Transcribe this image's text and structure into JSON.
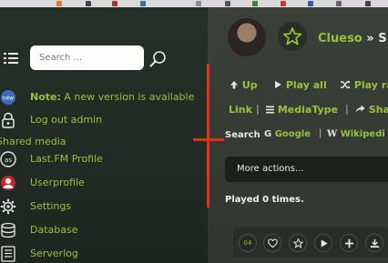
{
  "sidebar": {
    "search_placeholder": "Search ...",
    "note_prefix": "Note:",
    "note_text": " A new version is available",
    "logout": "Log out admin",
    "section_shared_media": "Shared media",
    "items": {
      "lastfm": "Last.FM Profile",
      "userprofile": "Userprofile",
      "settings": "Settings",
      "database": "Database",
      "serverlog": "Serverlog"
    }
  },
  "header": {
    "artist": "Clueso",
    "separator": "»",
    "trailing": "S"
  },
  "actions": {
    "up": "Up",
    "play_all": "Play all",
    "play_random": "Play ra",
    "link": "Link",
    "media_type": "MediaType",
    "share": "Sha"
  },
  "search_links": {
    "label": "Search",
    "google": "Google",
    "separator": "|",
    "wikipedia": "Wikipedi"
  },
  "more_actions": "More actions...",
  "played": "Played 0 times.",
  "track_bar": {
    "count": "04"
  },
  "colors": {
    "accent": "#97c33a",
    "sidebar_bg": "#1f2621",
    "main_bg": "#373b36",
    "annotation_red": "#e2301f"
  }
}
